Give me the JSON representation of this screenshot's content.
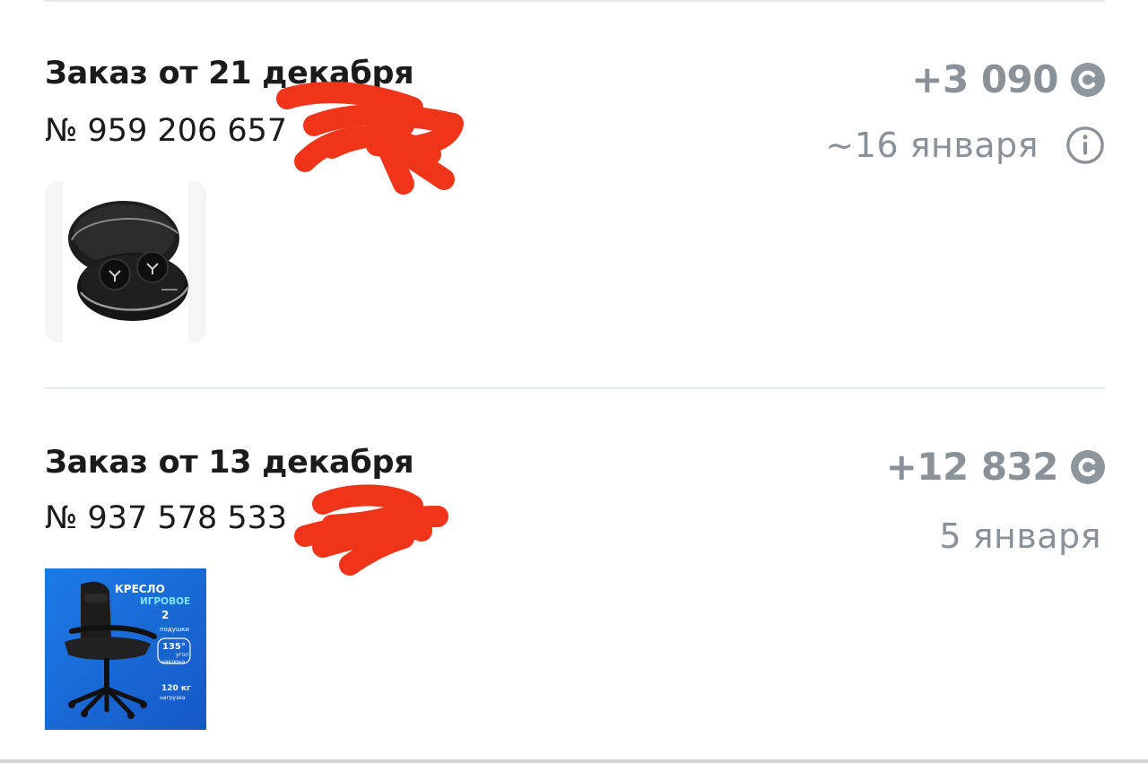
{
  "orders": [
    {
      "title": "Заказ от 21 декабря",
      "number": "№ 959 206 657",
      "bonus": "+3 090",
      "date": "~16 января",
      "product_icon": "wireless-earbuds-case"
    },
    {
      "title": "Заказ от 13 декабря",
      "number": "№ 937 578 533",
      "bonus": "+12 832",
      "date": "5 января",
      "product_icon": "gaming-chair",
      "product_card": {
        "line1": "КРЕСЛО",
        "line2": "ИГРОВОЕ",
        "feature1_value": "2",
        "feature1_label": "подушки",
        "feature2_value": "135°",
        "feature2_label_a": "угол",
        "feature2_label_b": "наклона",
        "feature3_value": "120 кг",
        "feature3_label": "нагрузка"
      }
    }
  ],
  "colors": {
    "text_primary": "#1b1b1b",
    "text_muted": "#8a9299",
    "divider": "#e6eaee",
    "redaction": "#f0341a",
    "chair_card_bg": "#1a73e0"
  }
}
